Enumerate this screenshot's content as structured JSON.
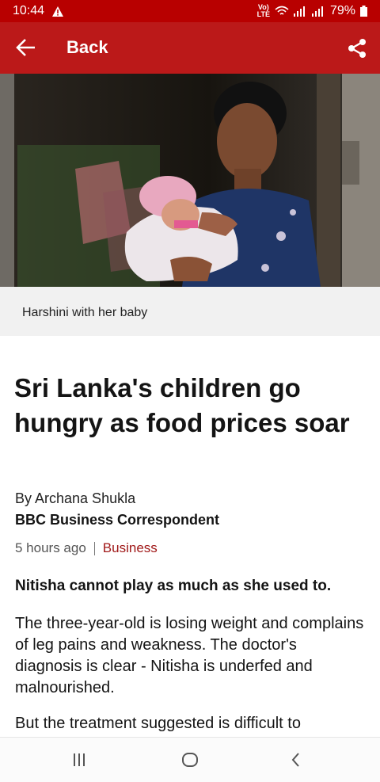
{
  "status_bar": {
    "time": "10:44",
    "network_top": "Vo)",
    "network_bottom": "LTE",
    "battery": "79%"
  },
  "app_bar": {
    "back_label": "Back"
  },
  "article": {
    "image_caption": "Harshini with her baby",
    "headline": "Sri Lanka's children go hungry as food prices soar",
    "author": "By Archana Shukla",
    "author_role": "BBC Business Correspondent",
    "time_ago": "5 hours ago",
    "topic": "Business",
    "lead": "Nitisha cannot play as much as she used to.",
    "paragraph_1": "The three-year-old is losing weight and complains of leg pains and weakness. The doctor's diagnosis is clear - Nitisha is underfed and malnourished.",
    "paragraph_2": "But the treatment suggested is difficult to"
  },
  "colors": {
    "brand_red": "#bb1919",
    "status_red": "#b80000",
    "topic_link": "#a01818"
  }
}
